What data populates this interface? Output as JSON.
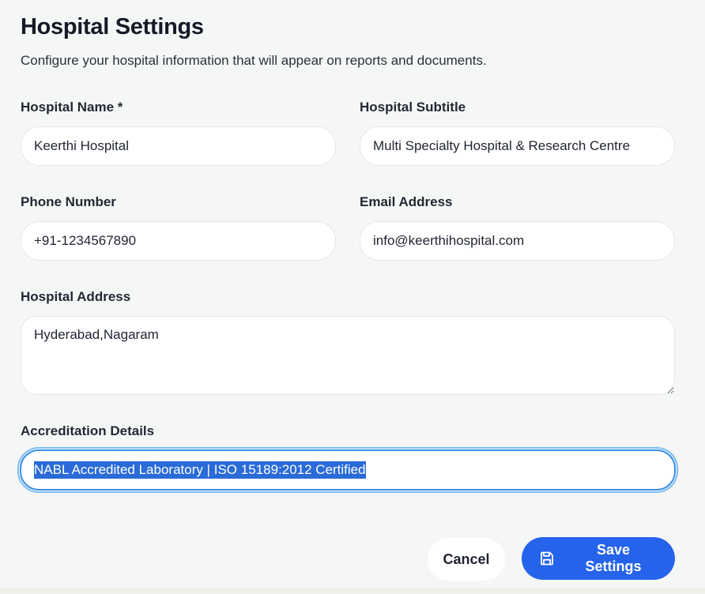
{
  "header": {
    "title": "Hospital Settings",
    "subtitle": "Configure your hospital information that will appear on reports and documents."
  },
  "form": {
    "hospital_name": {
      "label": "Hospital Name *",
      "value": "Keerthi Hospital"
    },
    "hospital_subtitle": {
      "label": "Hospital Subtitle",
      "value": "Multi Specialty Hospital & Research Centre"
    },
    "phone_number": {
      "label": "Phone Number",
      "value": "+91-1234567890"
    },
    "email_address": {
      "label": "Email Address",
      "value": "info@keerthihospital.com"
    },
    "hospital_address": {
      "label": "Hospital Address",
      "value": "Hyderabad,Nagaram"
    },
    "accreditation_details": {
      "label": "Accreditation Details",
      "value": "NABL Accredited Laboratory | ISO 15189:2012 Certified"
    }
  },
  "actions": {
    "cancel_label": "Cancel",
    "save_label": "Save Settings",
    "save_icon": "save-icon"
  },
  "colors": {
    "primary": "#2563eb",
    "focus_ring": "#3b8fe6",
    "selection": "#2a6bd8",
    "background": "#f5f7f7"
  }
}
